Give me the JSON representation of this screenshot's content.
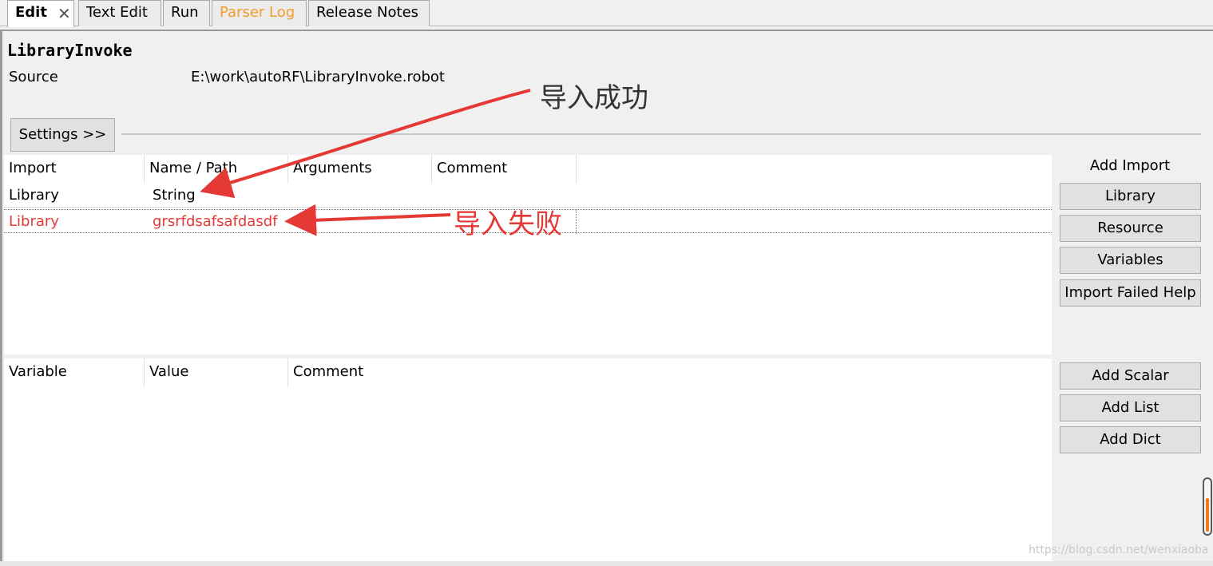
{
  "tabs": [
    {
      "label": "Edit",
      "active": true
    },
    {
      "label": "Text Edit"
    },
    {
      "label": "Run"
    },
    {
      "label": "Parser Log"
    },
    {
      "label": "Release Notes"
    }
  ],
  "close_icon_glyph": "✕",
  "suite": {
    "name": "LibraryInvoke",
    "source_label": "Source",
    "source_value": "E:\\work\\autoRF\\LibraryInvoke.robot"
  },
  "settings_button": "Settings >>",
  "imports": {
    "headers": [
      "Import",
      "Name / Path",
      "Arguments",
      "Comment"
    ],
    "rows": [
      {
        "type": "Library",
        "name": "String",
        "status": "ok"
      },
      {
        "type": "Library",
        "name": "grsrfdsafsafdasdf",
        "status": "failed"
      }
    ]
  },
  "add_import": {
    "label": "Add Import",
    "buttons": [
      "Library",
      "Resource",
      "Variables",
      "Import Failed Help"
    ]
  },
  "variables": {
    "headers": [
      "Variable",
      "Value",
      "Comment"
    ]
  },
  "variable_buttons": [
    "Add Scalar",
    "Add List",
    "Add Dict"
  ],
  "annotations": {
    "success": "导入成功",
    "failure": "导入失败"
  },
  "colors": {
    "failed_text": "#e53935",
    "parser_log_tab": "#f29d2a",
    "annotation_arrow": "#e53935",
    "scroll_thumb": "#f07a1e"
  },
  "watermark": "https://blog.csdn.net/wenxiaoba"
}
